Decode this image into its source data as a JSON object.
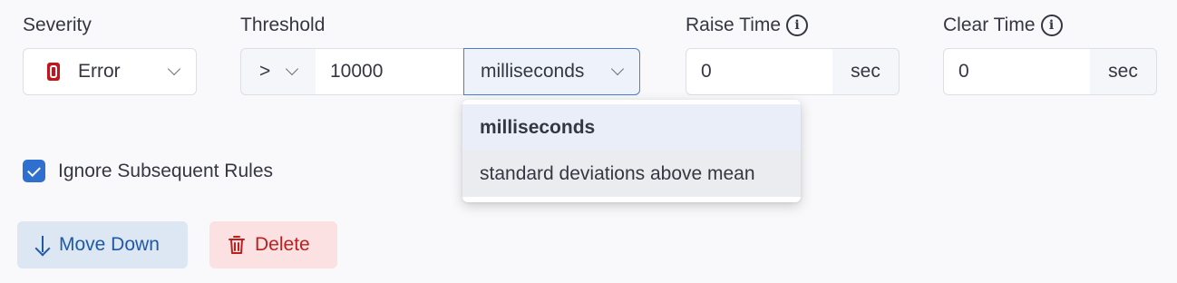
{
  "labels": {
    "severity": "Severity",
    "threshold": "Threshold",
    "raise_time": "Raise Time",
    "clear_time": "Clear Time",
    "info": "i"
  },
  "severity": {
    "value": "Error",
    "icon": "error-severity-icon",
    "icon_color": "#c4131a"
  },
  "threshold": {
    "operator": ">",
    "value": "10000",
    "unit": "milliseconds"
  },
  "unit_dropdown": {
    "options": [
      "milliseconds",
      "standard deviations above mean"
    ],
    "selected": "milliseconds"
  },
  "raise_time": {
    "value": "0",
    "unit": "sec"
  },
  "clear_time": {
    "value": "0",
    "unit": "sec"
  },
  "ignore_subsequent": {
    "label": "Ignore Subsequent Rules",
    "checked": true
  },
  "buttons": {
    "move_down": "Move Down",
    "delete": "Delete"
  },
  "colors": {
    "accent": "#2f6fcf",
    "danger": "#bd1f1f",
    "primary_text": "#1f5aa6"
  }
}
